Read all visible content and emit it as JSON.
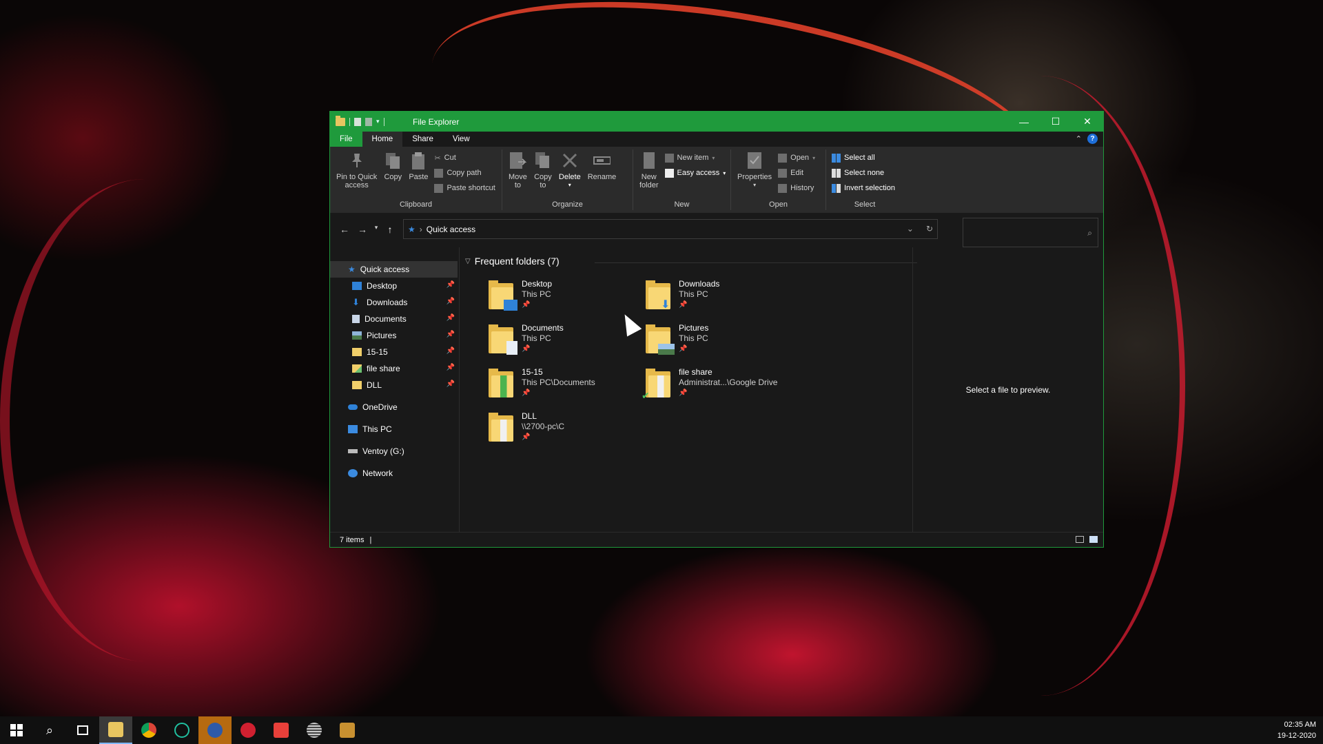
{
  "window": {
    "title": "File Explorer",
    "min_glyph": "—",
    "max_glyph": "☐",
    "close_glyph": "✕"
  },
  "ribbon_tabs": [
    "File",
    "Home",
    "Share",
    "View"
  ],
  "ribbon": {
    "clipboard": {
      "label": "Clipboard",
      "pin_label_1": "Pin to Quick",
      "pin_label_2": "access",
      "copy": "Copy",
      "paste": "Paste",
      "cut": "Cut",
      "copy_path": "Copy path",
      "paste_shortcut": "Paste shortcut"
    },
    "organize": {
      "label": "Organize",
      "move_to_1": "Move",
      "move_to_2": "to",
      "copy_to_1": "Copy",
      "copy_to_2": "to",
      "delete": "Delete",
      "rename": "Rename"
    },
    "new": {
      "label": "New",
      "new_folder_1": "New",
      "new_folder_2": "folder",
      "new_item": "New item",
      "easy_access": "Easy access"
    },
    "open": {
      "label": "Open",
      "properties": "Properties",
      "open": "Open",
      "edit": "Edit",
      "history": "History"
    },
    "select": {
      "label": "Select",
      "select_all": "Select all",
      "select_none": "Select none",
      "invert": "Invert selection"
    }
  },
  "address": {
    "path": "Quick access",
    "separator": "›",
    "search_placeholder": ""
  },
  "nav": {
    "quick_access": "Quick access",
    "items": [
      {
        "label": "Desktop",
        "icon": "desktop-icon"
      },
      {
        "label": "Downloads",
        "icon": "downloads-icon"
      },
      {
        "label": "Documents",
        "icon": "documents-icon"
      },
      {
        "label": "Pictures",
        "icon": "pictures-icon"
      },
      {
        "label": "15-15",
        "icon": "folder-icon"
      },
      {
        "label": "file share",
        "icon": "folder-icon"
      },
      {
        "label": "DLL",
        "icon": "folder-icon"
      }
    ],
    "onedrive": "OneDrive",
    "this_pc": "This PC",
    "ventoy": "Ventoy (G:)",
    "network": "Network",
    "pin_glyph": "📌"
  },
  "frequent": {
    "header": "Frequent folders (7)",
    "folders": [
      {
        "name": "Desktop",
        "location": "This PC"
      },
      {
        "name": "Downloads",
        "location": "This PC"
      },
      {
        "name": "Documents",
        "location": "This PC"
      },
      {
        "name": "Pictures",
        "location": "This PC"
      },
      {
        "name": "15-15",
        "location": "This PC\\Documents"
      },
      {
        "name": "file share",
        "location": "Administrat...\\Google Drive"
      },
      {
        "name": "DLL",
        "location": "\\\\2700-pc\\C"
      }
    ]
  },
  "preview_text": "Select a file to preview.",
  "status": {
    "items": "7 items"
  },
  "clock": {
    "time": "02:35 AM",
    "date": "19-12-2020"
  },
  "colors": {
    "accent": "#1f9a3c",
    "folder": "#f8d775"
  }
}
